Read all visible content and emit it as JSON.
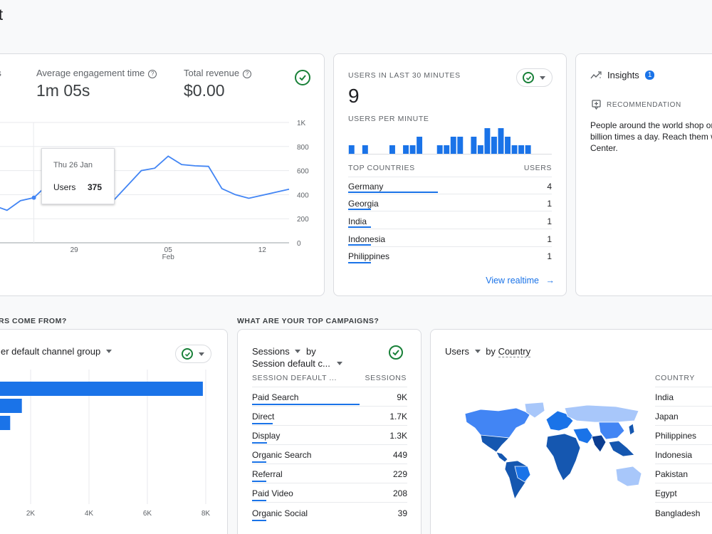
{
  "page": {
    "title_fragment": "t"
  },
  "top_card": {
    "metrics": [
      {
        "label": "rs",
        "value": ""
      },
      {
        "label": "Average engagement time",
        "value": "1m 05s"
      },
      {
        "label": "Total revenue",
        "value": "$0.00"
      }
    ],
    "tooltip": {
      "date": "Thu 26 Jan",
      "label": "Users",
      "value": "375"
    }
  },
  "chart_data": {
    "type": "line",
    "x": [
      "23 Jan",
      "24 Jan",
      "25 Jan",
      "26 Jan",
      "27 Jan",
      "28 Jan",
      "29 Jan",
      "30 Jan",
      "31 Jan",
      "01 Feb",
      "02 Feb",
      "03 Feb",
      "04 Feb",
      "05 Feb",
      "06 Feb",
      "07 Feb",
      "08 Feb",
      "09 Feb",
      "10 Feb",
      "11 Feb",
      "12 Feb",
      "13 Feb",
      "14 Feb"
    ],
    "values": [
      310,
      270,
      350,
      375,
      480,
      390,
      350,
      350,
      360,
      360,
      480,
      600,
      620,
      720,
      650,
      640,
      635,
      450,
      400,
      370,
      395,
      420,
      445
    ],
    "x_ticks": [
      {
        "label": "29",
        "sub": ""
      },
      {
        "label": "05",
        "sub": "Feb"
      },
      {
        "label": "12",
        "sub": ""
      }
    ],
    "y_ticks": [
      "0",
      "200",
      "400",
      "600",
      "800",
      "1K"
    ],
    "ylim": [
      0,
      1000
    ]
  },
  "realtime": {
    "title": "USERS IN LAST 30 MINUTES",
    "count": "9",
    "per_minute_label": "USERS PER MINUTE",
    "per_minute": [
      1,
      0,
      1,
      0,
      0,
      0,
      1,
      0,
      1,
      1,
      2,
      0,
      0,
      1,
      1,
      2,
      2,
      0,
      2,
      1,
      3,
      2,
      3,
      2,
      1,
      1,
      1,
      0,
      0,
      0
    ],
    "countries_header": "TOP COUNTRIES",
    "users_header": "USERS",
    "countries": [
      {
        "name": "Germany",
        "value": "4",
        "share": 1.0
      },
      {
        "name": "Georgia",
        "value": "1",
        "share": 0.25
      },
      {
        "name": "India",
        "value": "1",
        "share": 0.25
      },
      {
        "name": "Indonesia",
        "value": "1",
        "share": 0.25
      },
      {
        "name": "Philippines",
        "value": "1",
        "share": 0.25
      }
    ],
    "view_link": "View realtime"
  },
  "insights": {
    "title": "Insights",
    "badge": "1",
    "rec_label": "RECOMMENDATION",
    "lines": [
      "People around the world shop or",
      "billion times a day. Reach them w",
      "Center."
    ]
  },
  "section_left_title": "RS COME FROM?",
  "section_mid_title": "WHAT ARE YOUR TOP CAMPAIGNS?",
  "channel_card": {
    "selector": "er default channel group",
    "bars": [
      {
        "value": 7900
      },
      {
        "value": 1700
      },
      {
        "value": 1300
      }
    ],
    "x_ticks": [
      "2K",
      "4K",
      "6K",
      "8K"
    ],
    "xlim": [
      0,
      8000
    ]
  },
  "campaigns": {
    "metric": "Sessions",
    "by": "by",
    "dimension": "Session default c...",
    "col_left": "SESSION DEFAULT ...",
    "col_right": "SESSIONS",
    "rows": [
      {
        "name": "Paid Search",
        "value": "9K",
        "share": 1.0
      },
      {
        "name": "Direct",
        "value": "1.7K",
        "share": 0.19
      },
      {
        "name": "Display",
        "value": "1.3K",
        "share": 0.14
      },
      {
        "name": "Organic Search",
        "value": "449",
        "share": 0.05
      },
      {
        "name": "Referral",
        "value": "229",
        "share": 0.03
      },
      {
        "name": "Paid Video",
        "value": "208",
        "share": 0.02
      },
      {
        "name": "Organic Social",
        "value": "39",
        "share": 0.01
      }
    ]
  },
  "map_card": {
    "metric": "Users",
    "by": "by",
    "dimension": "Country",
    "col_header": "COUNTRY",
    "countries": [
      "India",
      "Japan",
      "Philippines",
      "Indonesia",
      "Pakistan",
      "Egypt",
      "Bangladesh"
    ]
  },
  "colors": {
    "accent": "#1a73e8",
    "check": "#188038",
    "map_dark": "#1557b0",
    "map_mid": "#4285f4",
    "map_light": "#a8c7fa"
  }
}
